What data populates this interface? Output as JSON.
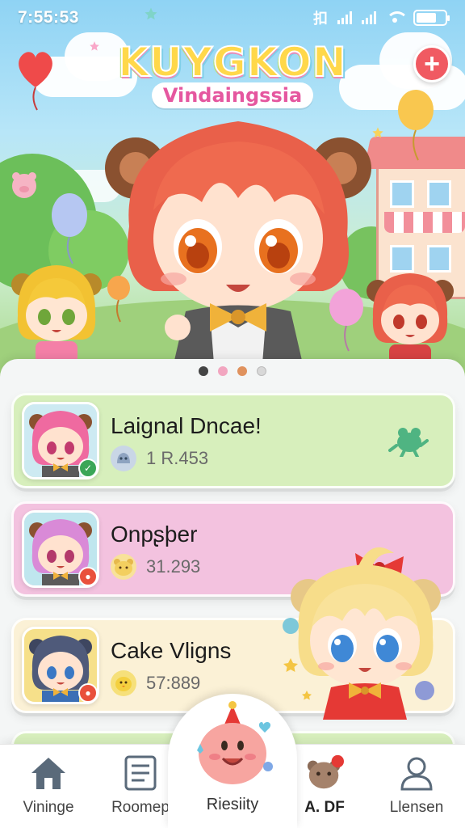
{
  "status_bar": {
    "time": "7:55:53",
    "network_label": "扣"
  },
  "hero": {
    "logo_title": "KUYGKON",
    "logo_subtitle": "Vindaingssia",
    "add_button_icon": "plus-icon",
    "carousel_pages": 4,
    "carousel_active": 0,
    "carousel_colors": [
      "#444444",
      "#f2a6c0",
      "#e0925e",
      "#d8d8d8"
    ]
  },
  "list": [
    {
      "title": "Laignal Dncae!",
      "value": "1 R.453",
      "bg": "#d7efbc",
      "stat_icon": "slime-icon",
      "stat_color": "#c9d6e6",
      "badge_color": "#3aa657",
      "hair": "#ef6aa0"
    },
    {
      "title": "Onpʂþer",
      "value": "31.293",
      "bg": "#f3c2df",
      "stat_icon": "bear-icon",
      "stat_color": "#f8e29a",
      "badge_color": "#e9503c",
      "hair": "#d98ad7"
    },
    {
      "title": "Cake Vligns",
      "value": "57:889",
      "bg": "#fbf1d6",
      "stat_icon": "chick-icon",
      "stat_color": "#f6e07a",
      "badge_color": "#e9503c",
      "hair": "#4f5a7a"
    }
  ],
  "nav": {
    "items": [
      {
        "label": "Vininge",
        "icon": "home-icon"
      },
      {
        "label": "Roomep",
        "icon": "list-icon"
      },
      {
        "label": "Riesiity",
        "icon": "mascot-icon"
      },
      {
        "label": "A. DF",
        "icon": "bear-badge-icon"
      },
      {
        "label": "Llensen",
        "icon": "profile-icon"
      }
    ]
  }
}
